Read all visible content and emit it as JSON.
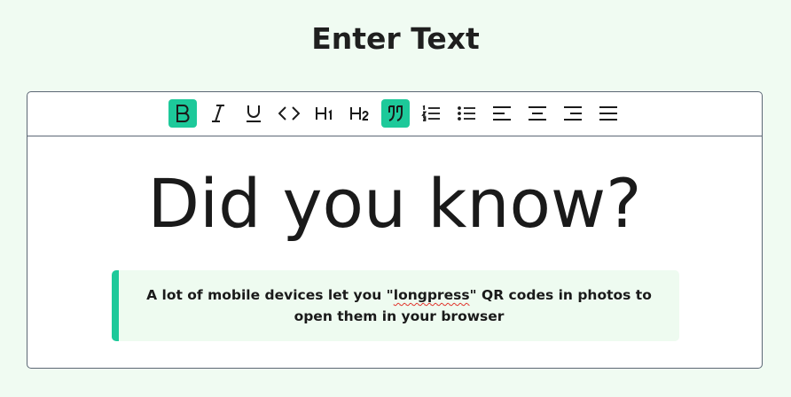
{
  "page": {
    "title": "Enter Text"
  },
  "toolbar": {
    "buttons": [
      {
        "name": "bold-button",
        "icon": "bold-icon",
        "active": true
      },
      {
        "name": "italic-button",
        "icon": "italic-icon",
        "active": false
      },
      {
        "name": "underline-button",
        "icon": "underline-icon",
        "active": false
      },
      {
        "name": "code-button",
        "icon": "code-icon",
        "active": false
      },
      {
        "name": "heading1-button",
        "icon": "heading1-icon",
        "active": false
      },
      {
        "name": "heading2-button",
        "icon": "heading2-icon",
        "active": false
      },
      {
        "name": "blockquote-button",
        "icon": "quote-icon",
        "active": true
      },
      {
        "name": "ordered-list-button",
        "icon": "ordered-list-icon",
        "active": false
      },
      {
        "name": "bullet-list-button",
        "icon": "bullet-list-icon",
        "active": false
      },
      {
        "name": "align-left-button",
        "icon": "align-left-icon",
        "active": false
      },
      {
        "name": "align-center-button",
        "icon": "align-center-icon",
        "active": false
      },
      {
        "name": "align-right-button",
        "icon": "align-right-icon",
        "active": false
      },
      {
        "name": "align-justify-button",
        "icon": "align-justify-icon",
        "active": false
      }
    ],
    "accent_color": "#1dc99a"
  },
  "editor": {
    "heading": "Did you know?",
    "quote_before": "A lot of mobile devices let you \"",
    "quote_misspelled": "longpress",
    "quote_after": "\" QR codes in photos to open them in your browser"
  }
}
